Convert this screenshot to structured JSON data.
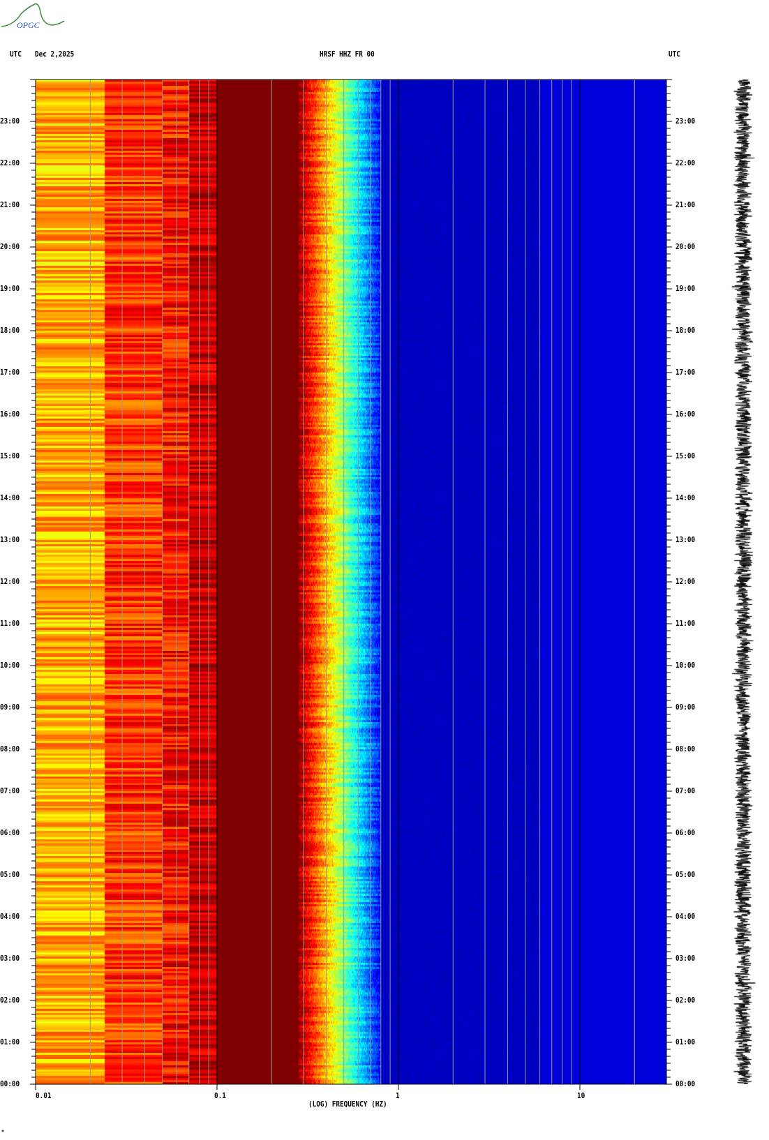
{
  "header": {
    "left_tz": "UTC",
    "date": "Dec 2,2025",
    "station": "HRSF HHZ FR 00",
    "right_tz": "UTC"
  },
  "logo_text": "OPGC",
  "footer_mark": "*",
  "colors": {
    "grid_minor": "#888888",
    "grid_major": "#000000",
    "background": "#ffffff"
  },
  "chart_data": {
    "type": "heatmap",
    "title": "HRSF HHZ FR 00",
    "date": "Dec 2,2025",
    "xlabel": "(LOG) FREQUENCY (HZ)",
    "ylabel": "UTC",
    "xscale": "log",
    "xlim": [
      0.01,
      30
    ],
    "x_ticks": [
      "0.01",
      "0.1",
      "1",
      "10"
    ],
    "x_tick_values": [
      0.01,
      0.1,
      1,
      10
    ],
    "ylim_hours": [
      0,
      24
    ],
    "y_ticks": [
      "00:00",
      "01:00",
      "02:00",
      "03:00",
      "04:00",
      "05:00",
      "06:00",
      "07:00",
      "08:00",
      "09:00",
      "10:00",
      "11:00",
      "12:00",
      "13:00",
      "14:00",
      "15:00",
      "16:00",
      "17:00",
      "18:00",
      "19:00",
      "20:00",
      "21:00",
      "22:00",
      "23:00"
    ],
    "colormap": "jet",
    "bands": [
      {
        "fmin": 0.01,
        "fmax": 0.024,
        "level": "high (yellow)"
      },
      {
        "fmin": 0.024,
        "fmax": 0.07,
        "level": "very high (orange-red)"
      },
      {
        "fmin": 0.1,
        "fmax": 0.28,
        "level": "maximum (dark red)"
      },
      {
        "fmin": 0.28,
        "fmax": 0.8,
        "level": "decreasing (red to cyan to blue)"
      },
      {
        "fmin": 0.8,
        "fmax": 30,
        "level": "low (blue)"
      }
    ]
  }
}
